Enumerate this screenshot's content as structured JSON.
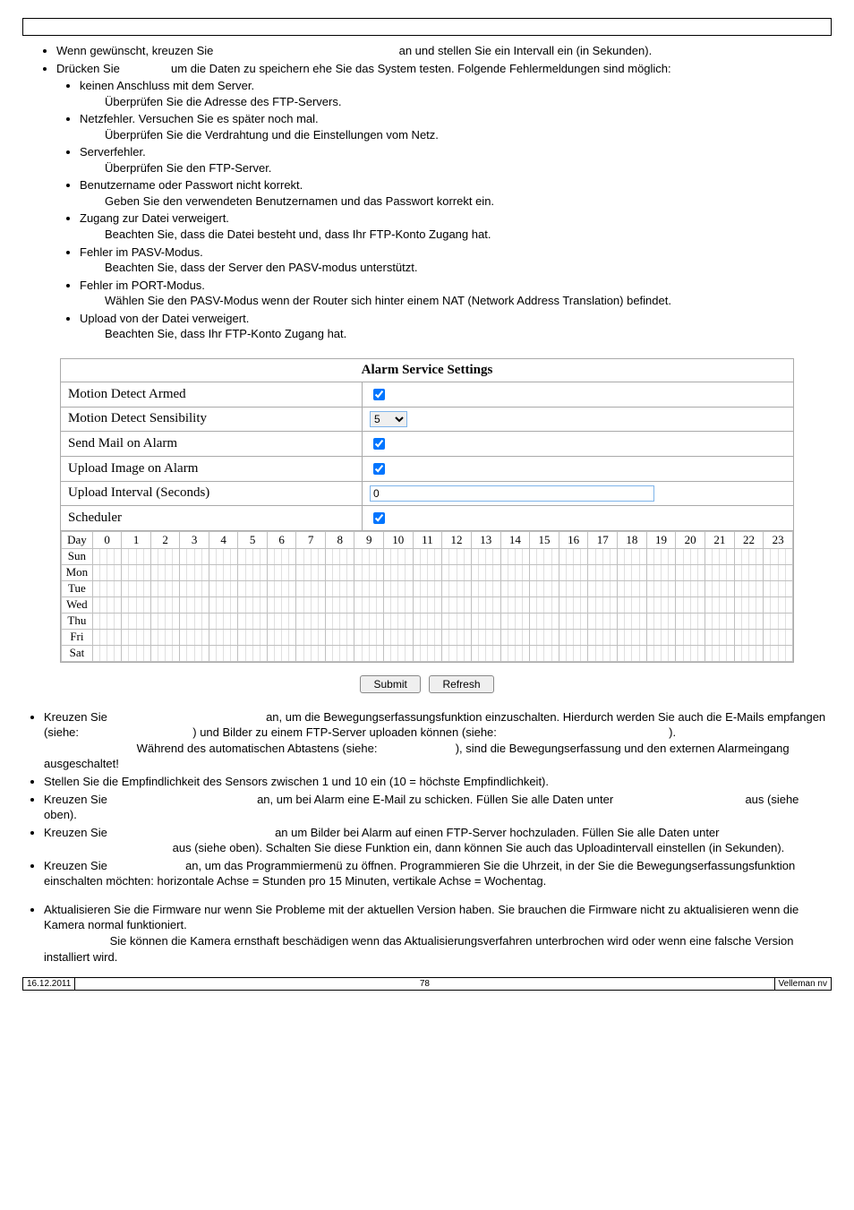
{
  "top_list": {
    "i1": {
      "a": "Wenn gewünscht, kreuzen Sie ",
      "b": " an und stellen Sie ein Intervall ein (in Sekunden)."
    },
    "i2": {
      "a": "Drücken Sie ",
      "b": " um die Daten zu speichern ehe Sie das System testen. Folgende Fehlermeldungen sind möglich:"
    },
    "sub": {
      "s1": "keinen Anschluss mit dem Server.",
      "s1b": "Überprüfen Sie die Adresse des FTP-Servers.",
      "s2": "Netzfehler. Versuchen Sie es später noch mal.",
      "s2b": "Überprüfen Sie die Verdrahtung und die Einstellungen vom Netz.",
      "s3": "Serverfehler.",
      "s3b": "Überprüfen Sie den FTP-Server.",
      "s4": "Benutzername oder Passwort nicht korrekt.",
      "s4b": "Geben Sie den verwendeten Benutzernamen und das Passwort korrekt ein.",
      "s5": "Zugang zur Datei verweigert.",
      "s5b": "Beachten Sie, dass die Datei besteht und, dass Ihr FTP-Konto Zugang hat.",
      "s6": "Fehler im PASV-Modus.",
      "s6b": "Beachten Sie, dass der Server den PASV-modus unterstützt.",
      "s7": "Fehler im PORT-Modus.",
      "s7b": "Wählen Sie den PASV-Modus wenn der Router sich hinter einem NAT (Network Address Translation) befindet.",
      "s8": "Upload von der Datei verweigert.",
      "s8b": "Beachten Sie, dass Ihr FTP-Konto Zugang hat."
    }
  },
  "settings": {
    "title": "Alarm Service Settings",
    "rows": {
      "r1": "Motion Detect Armed",
      "r2": "Motion Detect Sensibility",
      "r3": "Send Mail on Alarm",
      "r4": "Upload Image on Alarm",
      "r5": "Upload Interval (Seconds)",
      "r6": "Scheduler"
    },
    "sens_value": "5",
    "interval_value": "0",
    "days": [
      "Day",
      "Sun",
      "Mon",
      "Tue",
      "Wed",
      "Thu",
      "Fri",
      "Sat"
    ],
    "hours": [
      "0",
      "1",
      "2",
      "3",
      "4",
      "5",
      "6",
      "7",
      "8",
      "9",
      "10",
      "11",
      "12",
      "13",
      "14",
      "15",
      "16",
      "17",
      "18",
      "19",
      "20",
      "21",
      "22",
      "23"
    ]
  },
  "buttons": {
    "submit": "Submit",
    "refresh": "Refresh"
  },
  "lower": {
    "l1a": "Kreuzen Sie ",
    "l1b": " an, um die Bewegungserfassungsfunktion einzuschalten. Hierdurch werden Sie auch die E-Mails empfangen (siehe: ",
    "l1c": ") und Bilder zu einem FTP-Server uploaden können (siehe: ",
    "l1d": ").",
    "l1e": " Während des automatischen Abtastens (siehe: ",
    "l1f": "), sind die Bewegungserfassung und den externen Alarmeingang ausgeschaltet!",
    "l2": "Stellen Sie die Empfindlichkeit des Sensors zwischen 1 und 10 ein (10 = höchste Empfindlichkeit).",
    "l3a": "Kreuzen Sie ",
    "l3b": " an, um bei Alarm eine E-Mail zu schicken. Füllen Sie alle Daten unter ",
    "l3c": " aus (siehe oben).",
    "l4a": "Kreuzen Sie ",
    "l4b": " an um Bilder bei Alarm auf einen FTP-Server hochzuladen. Füllen Sie alle Daten unter ",
    "l4c": " aus (siehe oben). Schalten Sie diese Funktion ein, dann können Sie auch das Uploadintervall einstellen (in Sekunden).",
    "l5a": "Kreuzen Sie ",
    "l5b": " an, um das Programmiermenü zu öffnen. Programmieren Sie die Uhrzeit, in der Sie die Bewegungserfassungsfunktion einschalten möchten: horizontale Achse = Stunden pro 15 Minuten, vertikale Achse = Wochentag."
  },
  "firmware": {
    "f1": "Aktualisieren Sie die Firmware nur wenn Sie Probleme mit der aktuellen Version haben. Sie brauchen die Firmware nicht zu aktualisieren wenn die Kamera normal funktioniert.",
    "f2": " Sie können die Kamera ernsthaft beschädigen wenn das Aktualisierungsverfahren unterbrochen wird oder wenn eine falsche Version installiert wird."
  },
  "footer": {
    "date": "16.12.2011",
    "page": "78",
    "company": "Velleman nv"
  }
}
